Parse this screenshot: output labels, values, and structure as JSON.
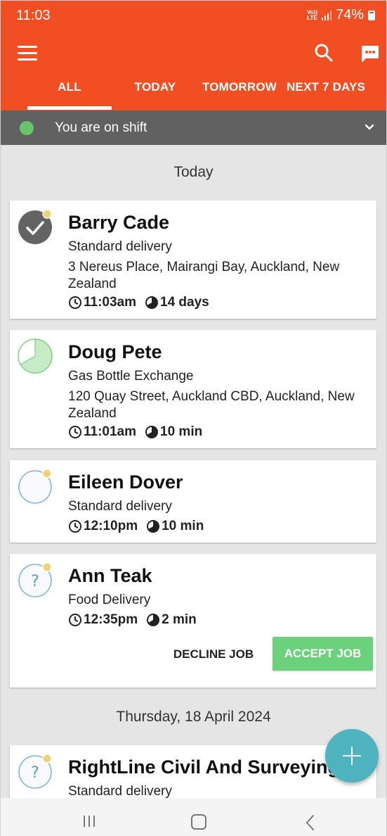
{
  "status_bar": {
    "time": "11:03",
    "volte": "Vo))\nLTE",
    "battery": "74%"
  },
  "tabs": [
    "ALL",
    "TODAY",
    "TOMORROW",
    "NEXT 7 DAYS"
  ],
  "shift": {
    "text": "You are on shift",
    "dot_color": "#67c46b"
  },
  "sections": {
    "today": "Today",
    "thursday": "Thursday, 18 April 2024"
  },
  "jobs": [
    {
      "name": "Barry Cade",
      "type": "Standard delivery",
      "address": "3 Nereus Place, Mairangi Bay, Auckland, New Zealand",
      "time": "11:03am",
      "duration": "14 days",
      "status": "completed"
    },
    {
      "name": "Doug Pete",
      "type": "Gas Bottle Exchange",
      "address": "120 Quay Street, Auckland CBD, Auckland, New Zealand",
      "time": "11:01am",
      "duration": "10 min",
      "status": "in-progress",
      "progress": 0.35
    },
    {
      "name": "Eileen Dover",
      "type": "Standard delivery",
      "time": "12:10pm",
      "duration": "10 min",
      "status": "pending"
    },
    {
      "name": "Ann Teak",
      "type": "Food Delivery",
      "time": "12:35pm",
      "duration": "2 min",
      "status": "unconfirmed",
      "decline_label": "DECLINE JOB",
      "accept_label": "ACCEPT JOB"
    },
    {
      "name": "RightLine Civil And Surveying",
      "type": "Standard delivery",
      "status": "unconfirmed"
    }
  ],
  "colors": {
    "brand": "#f24e23",
    "shift_bar": "#616161",
    "accept": "#6cd17c",
    "fab": "#4fb3bf",
    "notice_dot": "#f5cf72"
  }
}
